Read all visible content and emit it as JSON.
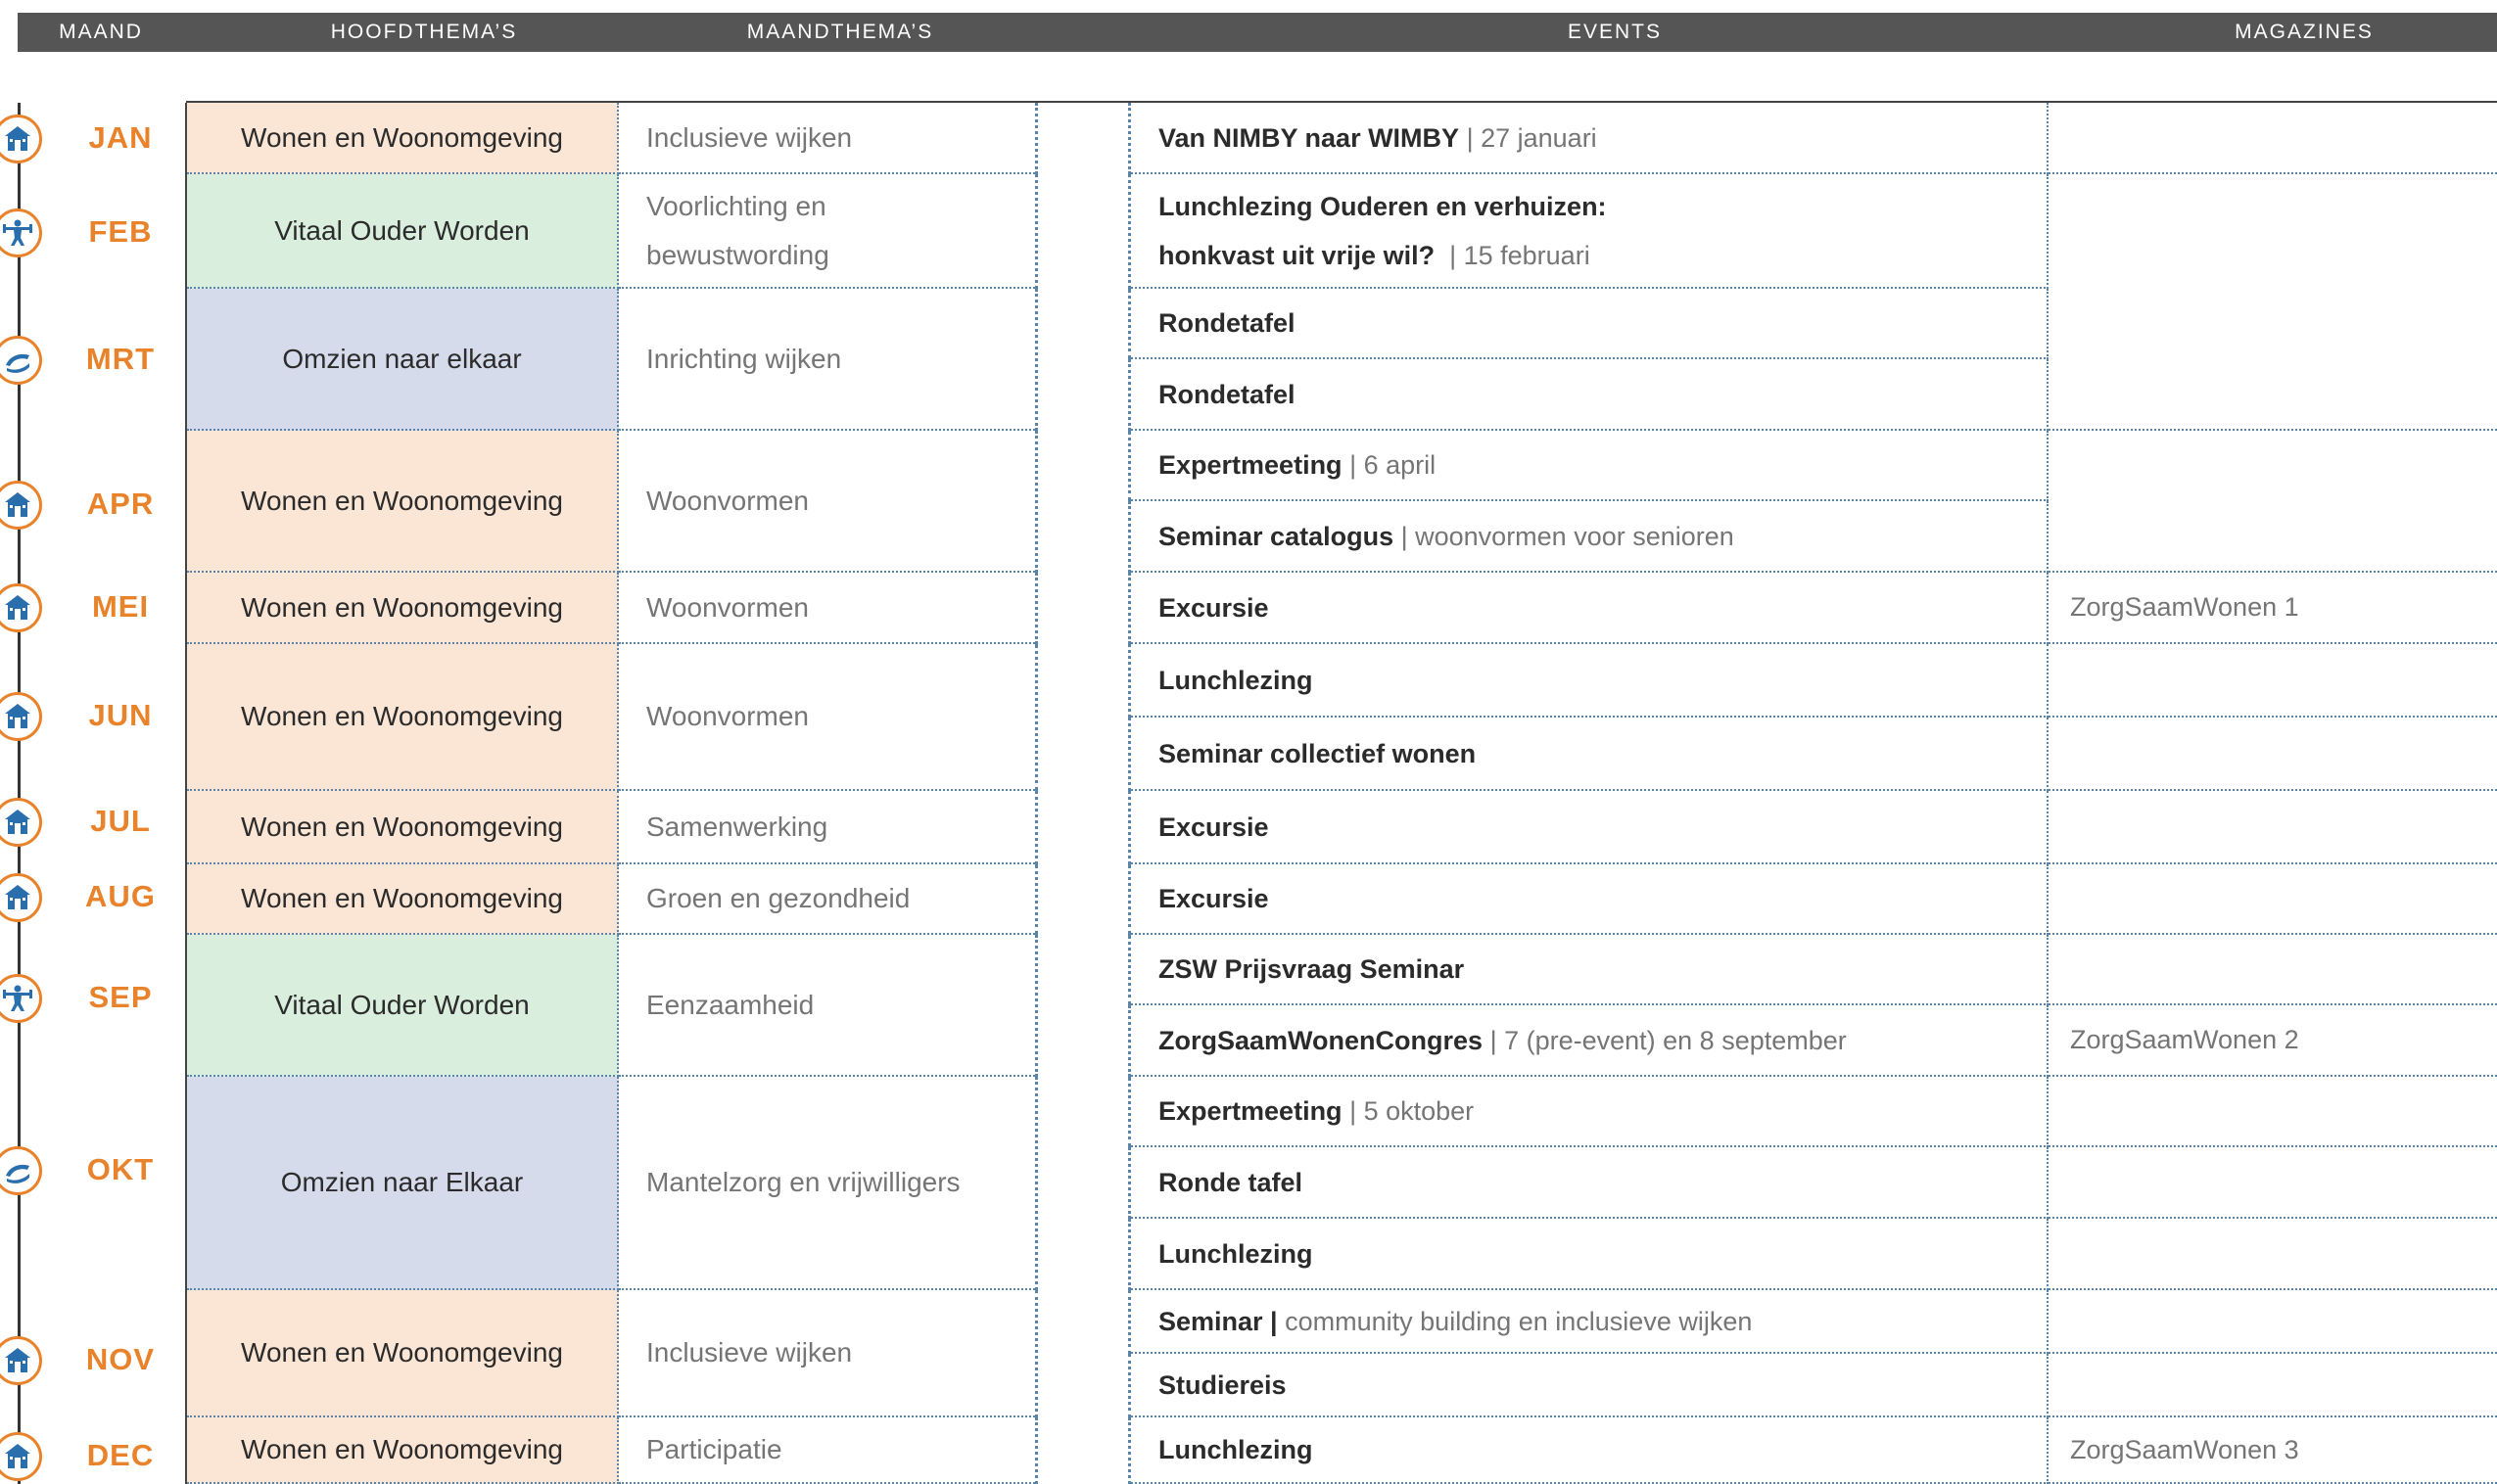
{
  "header": {
    "maand": "MAAND",
    "hoofdthemas": "HOOFDTHEMA’S",
    "maandthemas": "MAANDTHEMA’S",
    "events": "EVENTS",
    "magazines": "MAGAZINES"
  },
  "colors": {
    "header_bg": "#555555",
    "month_orange": "#e9832b",
    "icon_blue": "#2a6fad",
    "wonen_bg": "#fbe6d5",
    "vitaal_bg": "#d9eedc",
    "omzien_bg": "#d6dbeb",
    "dotted_border": "#5a84a8"
  },
  "months": [
    {
      "label": "JAN",
      "icon": "house-icon"
    },
    {
      "label": "FEB",
      "icon": "fitness-person-icon"
    },
    {
      "label": "MRT",
      "icon": "caring-hands-icon"
    },
    {
      "label": "APR",
      "icon": "house-icon"
    },
    {
      "label": "MEI",
      "icon": "house-icon"
    },
    {
      "label": "JUN",
      "icon": "house-icon"
    },
    {
      "label": "JUL",
      "icon": "house-icon"
    },
    {
      "label": "AUG",
      "icon": "house-icon"
    },
    {
      "label": "SEP",
      "icon": "fitness-person-icon"
    },
    {
      "label": "OKT",
      "icon": "caring-hands-icon"
    },
    {
      "label": "NOV",
      "icon": "house-icon"
    },
    {
      "label": "DEC",
      "icon": "house-icon"
    }
  ],
  "hoofdthemas": [
    {
      "label": "Wonen en Woonomgeving",
      "kind": "wonen"
    },
    {
      "label": "Vitaal Ouder Worden",
      "kind": "vitaal"
    },
    {
      "label": "Omzien naar elkaar",
      "kind": "omzien"
    },
    {
      "label": "Wonen en Woonomgeving",
      "kind": "wonen"
    },
    {
      "label": "Wonen en Woonomgeving",
      "kind": "wonen"
    },
    {
      "label": "Wonen en Woonomgeving",
      "kind": "wonen"
    },
    {
      "label": "Wonen en Woonomgeving",
      "kind": "wonen"
    },
    {
      "label": "Wonen en Woonomgeving",
      "kind": "wonen"
    },
    {
      "label": "Vitaal Ouder Worden",
      "kind": "vitaal"
    },
    {
      "label": "Omzien naar Elkaar",
      "kind": "omzien"
    },
    {
      "label": "Wonen en Woonomgeving",
      "kind": "wonen"
    },
    {
      "label": "Wonen en Woonomgeving",
      "kind": "wonen"
    }
  ],
  "maandthemas": [
    {
      "lines": [
        "Inclusieve wijken"
      ]
    },
    {
      "lines": [
        "Voorlichting en",
        "bewustwording"
      ]
    },
    {
      "lines": [
        "Inrichting wijken"
      ]
    },
    {
      "lines": [
        "Woonvormen"
      ]
    },
    {
      "lines": [
        "Woonvormen"
      ]
    },
    {
      "lines": [
        "Woonvormen"
      ]
    },
    {
      "lines": [
        "Samenwerking"
      ]
    },
    {
      "lines": [
        "Groen en gezondheid"
      ]
    },
    {
      "lines": [
        "Eenzaamheid"
      ]
    },
    {
      "lines": [
        "Mantelzorg en vrijwilligers"
      ]
    },
    {
      "lines": [
        "Inclusieve wijken"
      ]
    },
    {
      "lines": [
        "Participatie"
      ]
    }
  ],
  "events": [
    {
      "title": "Van NIMBY naar WIMBY",
      "detail": "| 27 januari"
    },
    {
      "title": "Lunchlezing Ouderen en verhuizen:",
      "title2": "honkvast uit vrije wil?",
      "detail": "| 15 februari"
    },
    {
      "title": "Rondetafel",
      "detail": ""
    },
    {
      "title": "Rondetafel",
      "detail": ""
    },
    {
      "title": "Expertmeeting",
      "detail": "| 6 april"
    },
    {
      "title": "Seminar catalogus",
      "detail": "| woonvormen voor senioren"
    },
    {
      "title": "Excursie",
      "detail": ""
    },
    {
      "title": "Lunchlezing",
      "detail": ""
    },
    {
      "title": "Seminar collectief wonen",
      "detail": ""
    },
    {
      "title": "Excursie",
      "detail": ""
    },
    {
      "title": "Excursie",
      "detail": ""
    },
    {
      "title": "ZSW Prijsvraag Seminar",
      "detail": ""
    },
    {
      "title": "ZorgSaamWonenCongres",
      "detail": "| 7 (pre-event) en 8 september"
    },
    {
      "title": "Expertmeeting",
      "detail": "| 5 oktober"
    },
    {
      "title": "Ronde tafel",
      "detail": ""
    },
    {
      "title": "Lunchlezing",
      "detail": ""
    },
    {
      "title": "Seminar |",
      "detail": "community building en inclusieve wijken"
    },
    {
      "title": "Studiereis",
      "detail": ""
    },
    {
      "title": "Lunchlezing",
      "detail": ""
    }
  ],
  "magazines": [
    {
      "label": ""
    },
    {
      "label": ""
    },
    {
      "label": ""
    },
    {
      "label": "ZorgSaamWonen 1"
    },
    {
      "label": ""
    },
    {
      "label": ""
    },
    {
      "label": ""
    },
    {
      "label": ""
    },
    {
      "label": ""
    },
    {
      "label": "ZorgSaamWonen 2"
    },
    {
      "label": ""
    },
    {
      "label": ""
    },
    {
      "label": ""
    },
    {
      "label": ""
    },
    {
      "label": ""
    },
    {
      "label": "ZorgSaamWonen 3"
    }
  ]
}
